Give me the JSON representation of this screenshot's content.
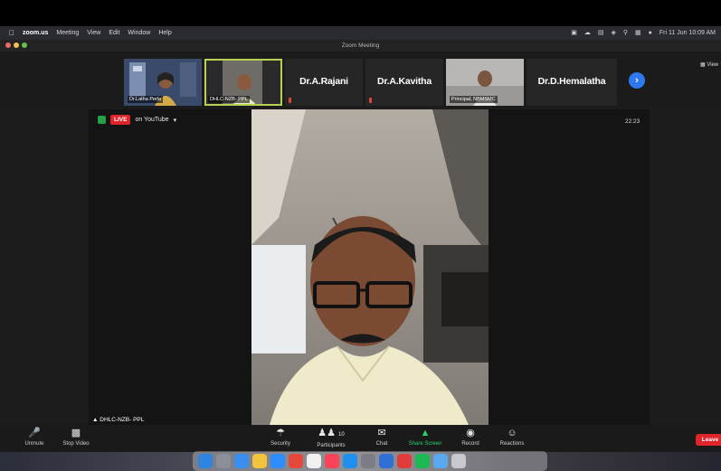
{
  "menubar": {
    "app": "zoom.us",
    "items": [
      "Meeting",
      "View",
      "Edit",
      "Window",
      "Help"
    ],
    "clock": "Fri 11 Jun 10:09 AM"
  },
  "window": {
    "title": "Zoom Meeting"
  },
  "participants": [
    {
      "name": "Dr.Latha Perla",
      "type": "video"
    },
    {
      "name": "DHLC-NZB- PPL",
      "type": "video",
      "active": true
    },
    {
      "name": "Dr.A.Rajani",
      "type": "name"
    },
    {
      "name": "Dr.A.Kavitha",
      "type": "name"
    },
    {
      "name": "Principal, NBMSMC",
      "type": "video"
    },
    {
      "name": "Dr.D.Hemalatha",
      "type": "name"
    }
  ],
  "view_label": "View",
  "live": {
    "badge": "LIVE",
    "text": "on YouTube"
  },
  "timer": "22:23",
  "speaker_name": "DHLC-NZB- PPL",
  "toolbar": {
    "unmute": "Unmute",
    "stop_video": "Stop Video",
    "security": "Security",
    "participants": "Participants",
    "participants_count": "10",
    "chat": "Chat",
    "share": "Share Screen",
    "record": "Record",
    "reactions": "Reactions",
    "leave": "Leave"
  },
  "colors": {
    "live_red": "#e0242b",
    "share_green": "#2ed16a",
    "active_border": "#b7d155",
    "accent_blue": "#2e79ef"
  }
}
